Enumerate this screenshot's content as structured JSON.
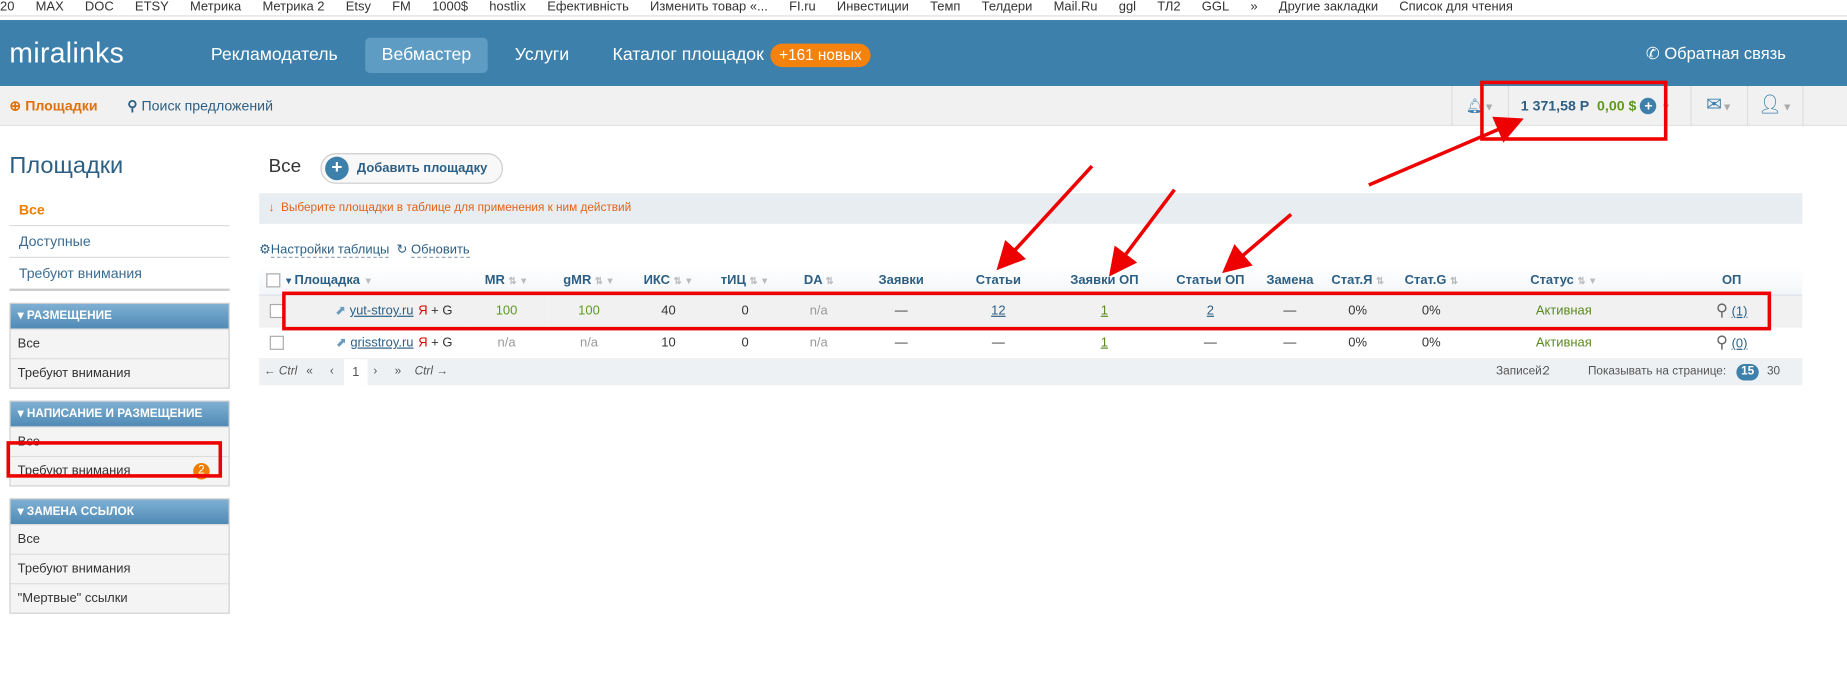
{
  "bookmarks": [
    "20",
    "MAX",
    "DOC",
    "ETSY",
    "Метрика",
    "Метрика 2",
    "Etsy",
    "FM",
    "1000$",
    "hostlix",
    "Ефективність",
    "Изменить товар «...",
    "FI.ru",
    "Инвестиции",
    "Темп",
    "Телдери",
    "Mail.Ru",
    "ggl",
    "ТЛ2",
    "GGL",
    "»",
    "Другие закладки",
    "Список для чтения"
  ],
  "header": {
    "logo": "miralinks",
    "nav": [
      "Рекламодатель",
      "Вебмастер",
      "Услуги",
      "Каталог площадок"
    ],
    "new_badge": "+161 новых",
    "feedback": "Обратная связь"
  },
  "subnav": {
    "sites": "Площадки",
    "search": "Поиск предложений",
    "balance_rub": "1 371,58 Р",
    "balance_usd": "0,00 $"
  },
  "sidebar": {
    "title": "Площадки",
    "links": [
      "Все",
      "Доступные",
      "Требуют внимания"
    ],
    "groups": [
      {
        "title": "Размещение",
        "items": [
          "Все",
          "Требуют внимания"
        ]
      },
      {
        "title": "Написание и размещение",
        "items": [
          "Все",
          "Требуют внимания"
        ],
        "count": "2"
      },
      {
        "title": "Замена ссылок",
        "items": [
          "Все",
          "Требуют внимания",
          "\"Мертвые\" ссылки"
        ]
      }
    ]
  },
  "main": {
    "title": "Все",
    "add": "Добавить площадку",
    "hint": "Выберите площадки в таблице для применения к ним действий",
    "settings": "Настройки таблицы",
    "refresh": "Обновить",
    "columns": [
      "Площадка",
      "MR",
      "gMR",
      "ИКС",
      "тИЦ",
      "DA",
      "Заявки",
      "Статьи",
      "Заявки ОП",
      "Статьи ОП",
      "Замена",
      "Стат.Я",
      "Стат.G",
      "Статус",
      "ОП"
    ],
    "rows": [
      {
        "site": "yut-stroy.ru",
        "se": "Я",
        "se2": "+ G",
        "mr": "100",
        "gmr": "100",
        "iks": "40",
        "tic": "0",
        "da": "n/a",
        "req": "—",
        "art": "12",
        "req_op": "1",
        "art_op": "2",
        "repl": "—",
        "sy": "0%",
        "sg": "0%",
        "status": "Активная",
        "op": "(1)"
      },
      {
        "site": "grisstroy.ru",
        "se": "Я",
        "se2": "+ G",
        "mr": "n/a",
        "gmr": "n/a",
        "iks": "10",
        "tic": "0",
        "da": "n/a",
        "req": "—",
        "art": "—",
        "req_op": "1",
        "art_op": "—",
        "repl": "—",
        "sy": "0%",
        "sg": "0%",
        "status": "Активная",
        "op": "(0)"
      }
    ],
    "pager": {
      "prev": "← Ctrl",
      "first": "«",
      "back": "‹",
      "page": "1",
      "next": "›",
      "last": "»",
      "nextk": "Ctrl →",
      "records_label": "Записей:",
      "records": "2",
      "per_page_label": "Показывать на странице:",
      "per_page": "15",
      "per_page_alt": "30"
    }
  }
}
